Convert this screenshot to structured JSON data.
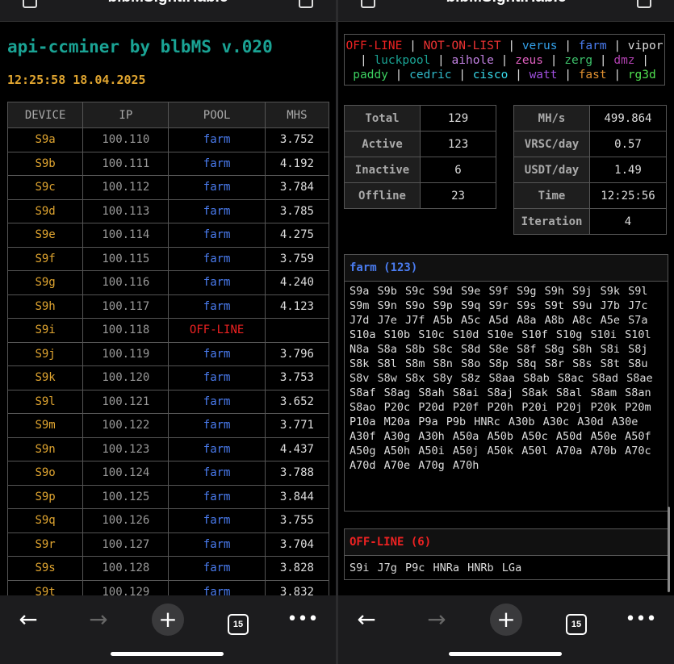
{
  "browser": {
    "url_text": "blbMSightIHabIc",
    "tab_count": "15"
  },
  "left": {
    "title": "api-ccminer by blbMS v.020",
    "timestamp": "12:25:58 18.04.2025",
    "columns": [
      "DEVICE",
      "IP",
      "POOL",
      "MHS"
    ],
    "rows": [
      {
        "device": "S9a",
        "ip": "100.110",
        "pool": "farm",
        "mhs": "3.752"
      },
      {
        "device": "S9b",
        "ip": "100.111",
        "pool": "farm",
        "mhs": "4.192"
      },
      {
        "device": "S9c",
        "ip": "100.112",
        "pool": "farm",
        "mhs": "3.784"
      },
      {
        "device": "S9d",
        "ip": "100.113",
        "pool": "farm",
        "mhs": "3.785"
      },
      {
        "device": "S9e",
        "ip": "100.114",
        "pool": "farm",
        "mhs": "4.275"
      },
      {
        "device": "S9f",
        "ip": "100.115",
        "pool": "farm",
        "mhs": "3.759"
      },
      {
        "device": "S9g",
        "ip": "100.116",
        "pool": "farm",
        "mhs": "4.240"
      },
      {
        "device": "S9h",
        "ip": "100.117",
        "pool": "farm",
        "mhs": "4.123"
      },
      {
        "device": "S9i",
        "ip": "100.118",
        "pool": "OFF-LINE",
        "mhs": ""
      },
      {
        "device": "S9j",
        "ip": "100.119",
        "pool": "farm",
        "mhs": "3.796"
      },
      {
        "device": "S9k",
        "ip": "100.120",
        "pool": "farm",
        "mhs": "3.753"
      },
      {
        "device": "S9l",
        "ip": "100.121",
        "pool": "farm",
        "mhs": "3.652"
      },
      {
        "device": "S9m",
        "ip": "100.122",
        "pool": "farm",
        "mhs": "3.771"
      },
      {
        "device": "S9n",
        "ip": "100.123",
        "pool": "farm",
        "mhs": "4.437"
      },
      {
        "device": "S9o",
        "ip": "100.124",
        "pool": "farm",
        "mhs": "3.788"
      },
      {
        "device": "S9p",
        "ip": "100.125",
        "pool": "farm",
        "mhs": "3.844"
      },
      {
        "device": "S9q",
        "ip": "100.126",
        "pool": "farm",
        "mhs": "3.755"
      },
      {
        "device": "S9r",
        "ip": "100.127",
        "pool": "farm",
        "mhs": "3.704"
      },
      {
        "device": "S9s",
        "ip": "100.128",
        "pool": "farm",
        "mhs": "3.828"
      },
      {
        "device": "S9t",
        "ip": "100.129",
        "pool": "farm",
        "mhs": "3.832"
      }
    ]
  },
  "right": {
    "legend": [
      {
        "label": "OFF-LINE",
        "color": "#ee2222"
      },
      {
        "label": "NOT-ON-LIST",
        "color": "#ee3333"
      },
      {
        "label": "verus",
        "color": "#33a0e8"
      },
      {
        "label": "farm",
        "color": "#4a7cf0"
      },
      {
        "label": "vipor",
        "color": "#dddddd"
      },
      {
        "label": "luckpool",
        "color": "#1aa394"
      },
      {
        "label": "aihole",
        "color": "#c080e0"
      },
      {
        "label": "zeus",
        "color": "#e060c0"
      },
      {
        "label": "zerg",
        "color": "#3cc06a"
      },
      {
        "label": "dmz",
        "color": "#b040b0"
      },
      {
        "label": "paddy",
        "color": "#3cd060"
      },
      {
        "label": "cedric",
        "color": "#30b8c8"
      },
      {
        "label": "cisco",
        "color": "#38d8e8"
      },
      {
        "label": "watt",
        "color": "#a050e0"
      },
      {
        "label": "fast",
        "color": "#e09030"
      },
      {
        "label": "rg3d",
        "color": "#50e050"
      }
    ],
    "stats_left": [
      {
        "key": "Total",
        "value": "129"
      },
      {
        "key": "Active",
        "value": "123"
      },
      {
        "key": "Inactive",
        "value": "6"
      },
      {
        "key": "Offline",
        "value": "23"
      }
    ],
    "stats_right": [
      {
        "key": "MH/s",
        "value": "499.864"
      },
      {
        "key": "VRSC/day",
        "value": "0.57"
      },
      {
        "key": "USDT/day",
        "value": "1.49"
      },
      {
        "key": "Time",
        "value": "12:25:56"
      },
      {
        "key": "Iteration",
        "value": "4"
      }
    ],
    "farm_header": "farm (123)",
    "farm_devices": "S9a S9b S9c S9d S9e S9f S9g S9h S9j S9k S9l S9m S9n S9o S9p S9q S9r S9s S9t S9u J7b J7c J7d J7e J7f A5b A5c A5d A8a A8b A8c A5e S7a S10a S10b S10c S10d S10e S10f S10g S10i S10l N8a S8a S8b S8c S8d S8e S8f S8g S8h S8i S8j S8k S8l S8m S8n S8o S8p S8q S8r S8s S8t S8u S8v S8w S8x S8y S8z S8aa S8ab S8ac S8ad S8ae S8af S8ag S8ah S8ai S8aj S8ak S8al S8am S8an S8ao P20c P20d P20f P20h P20i P20j P20k P20m P10a M20a P9a P9b HNRc A30b A30c A30d A30e A30f A30g A30h A50a A50b A50c A50d A50e A50f A50g A50h A50i A50j A50k A50l A70a A70b A70c A70d A70e A70g A70h",
    "offline_header": "OFF-LINE (6)",
    "offline_devices": "S9i J7g P9c HNRa HNRb LGa"
  },
  "toolbar": {
    "back_icon": "arrow-left-icon",
    "forward_icon": "arrow-right-icon",
    "new_tab_icon": "plus-icon",
    "more_icon": "ellipsis-icon"
  }
}
